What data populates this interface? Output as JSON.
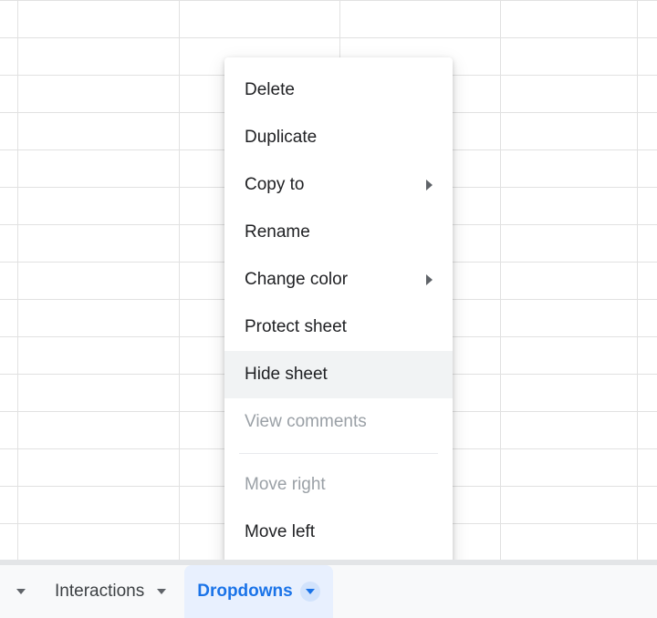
{
  "menu": {
    "delete": "Delete",
    "duplicate": "Duplicate",
    "copy_to": "Copy to",
    "rename": "Rename",
    "change_color": "Change color",
    "protect_sheet": "Protect sheet",
    "hide_sheet": "Hide sheet",
    "view_comments": "View comments",
    "move_right": "Move right",
    "move_left": "Move left"
  },
  "tabs": {
    "interactions": "Interactions",
    "dropdowns": "Dropdowns"
  }
}
